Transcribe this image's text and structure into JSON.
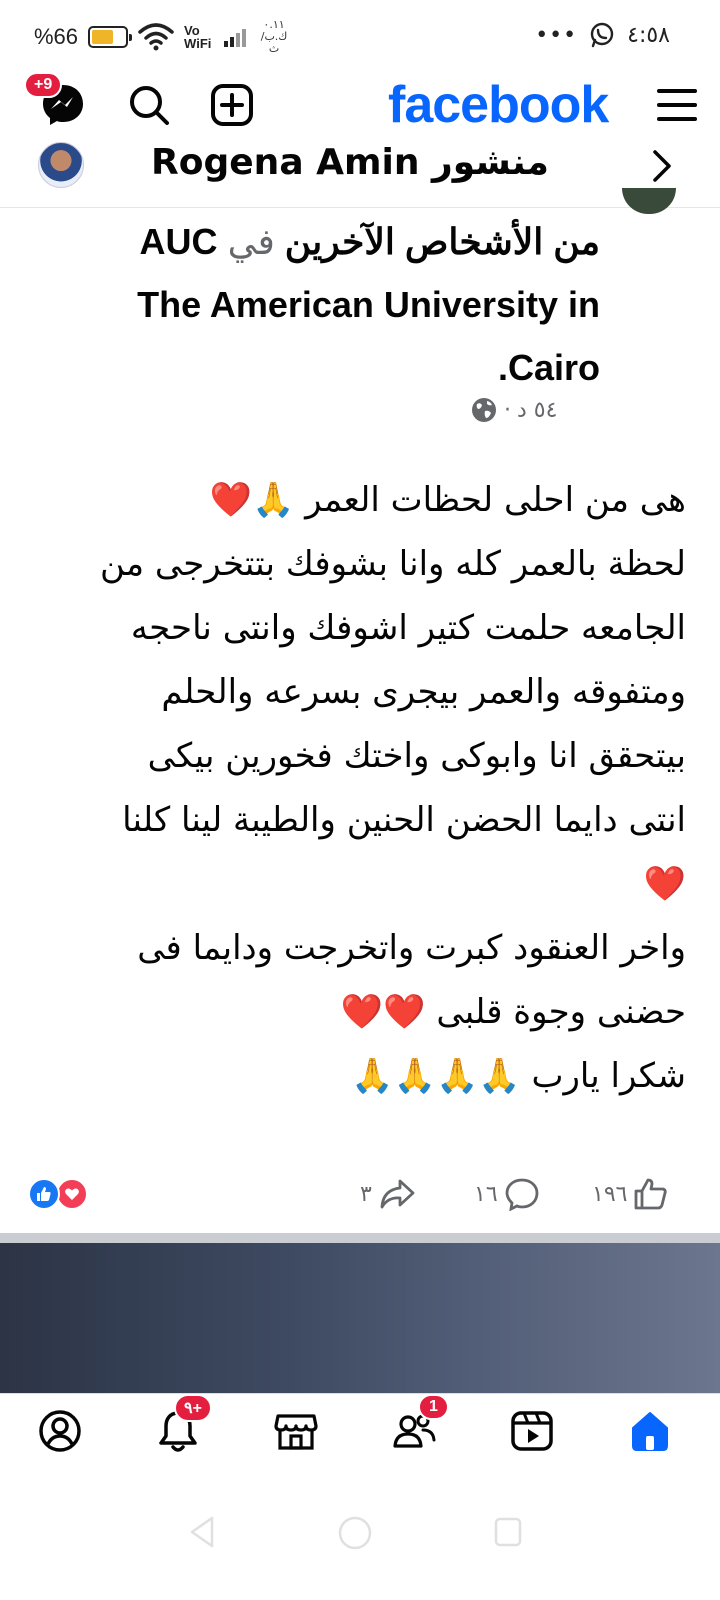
{
  "status_bar": {
    "battery_text": "%66",
    "battery_level": 0.66,
    "network_label": "Vo WiFi",
    "net_speed": "٠.١١ ك.ب/ث",
    "overflow": "•••",
    "time": "٤:٥٨",
    "icons": [
      "battery-icon",
      "wifi-icon",
      "signal-icon",
      "whatsapp-icon"
    ]
  },
  "header": {
    "logo": "facebook",
    "messenger_badge": "+9",
    "icons": [
      "messenger-icon",
      "search-icon",
      "create-icon",
      "menu-icon"
    ]
  },
  "post_bar": {
    "title": "منشور Rogena Amin"
  },
  "post": {
    "context_bold": "AUC",
    "context_in": "في",
    "context_rest": "من الأشخاص الآخرين",
    "context_line2": "The American University in",
    "context_line3": "Cairo.",
    "time": "٥٤ د",
    "dot": "·",
    "body": [
      "هى من  احلى لحظات العمر 🙏❤️",
      "لحظة بالعمر كله وانا بشوفك بتتخرجى من",
      "الجامعه حلمت كتير اشوفك وانتى ناحجه",
      "ومتفوقه والعمر بيجرى بسرعه والحلم",
      "بيتحقق انا وابوكى واختك فخورين بيكى",
      "انتى دايما الحضن الحنين والطيبة لينا كلنا",
      "❤️",
      "واخر العنقود كبرت واتخرجت ودايما فى",
      "حضنى وجوة قلبى ❤️❤️",
      "شكرا يارب  🙏🙏🙏🙏"
    ]
  },
  "engagement": {
    "likes": "١٩٦",
    "comments": "١٦",
    "shares": "٣"
  },
  "bottom_nav": {
    "notifications_badge": "٩+",
    "friends_badge": "1",
    "items": [
      "profile-icon",
      "notifications-icon",
      "marketplace-icon",
      "friends-icon",
      "video-icon",
      "home-icon"
    ],
    "active": "home-icon",
    "accent": "#0866ff"
  },
  "colors": {
    "brand": "#0866ff",
    "badge": "#e41e3f",
    "like": "#1877f2",
    "love": "#f33e58"
  }
}
